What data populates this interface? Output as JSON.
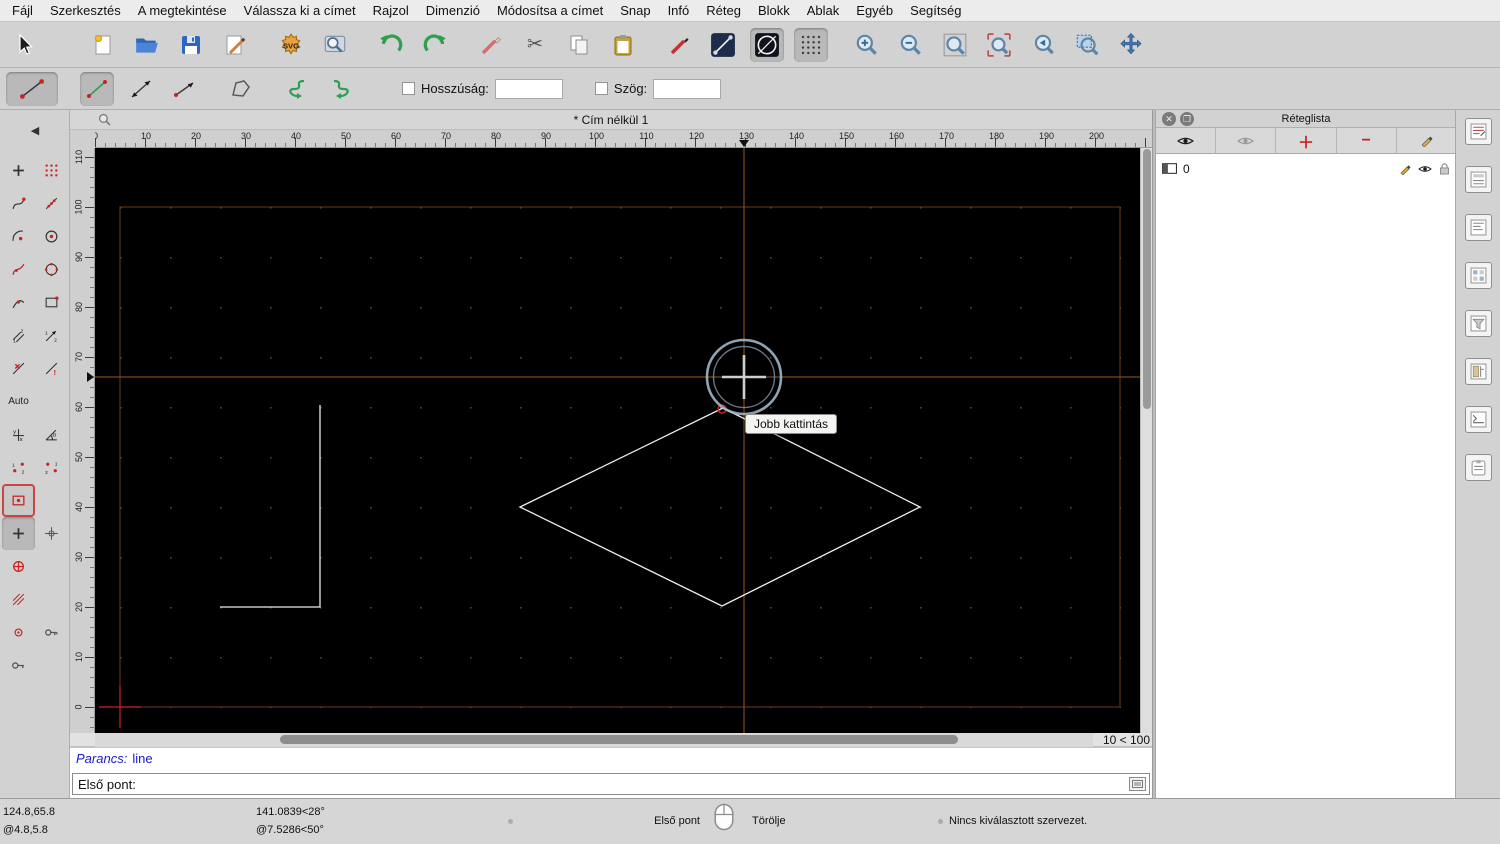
{
  "menu_bar": {
    "items": [
      "Fájl",
      "Szerkesztés",
      "A megtekintése",
      "Válassza ki a címet",
      "Rajzol",
      "Dimenzió",
      "Módosítsa a címet",
      "Snap",
      "Infó",
      "Réteg",
      "Blokk",
      "Ablak",
      "Egyéb",
      "Segítség"
    ]
  },
  "options_bar": {
    "length_label": "Hosszúság:",
    "length_value": "",
    "angle_label": "Szög:",
    "angle_value": ""
  },
  "titlebar": {
    "title": "* Cím nélkül 1"
  },
  "rulers": {
    "horizontal": [
      "0",
      "10",
      "20",
      "30",
      "40",
      "50",
      "60",
      "70",
      "80",
      "90",
      "100",
      "110",
      "120",
      "130",
      "140",
      "150",
      "160",
      "170",
      "180",
      "190",
      "200"
    ],
    "vertical": [
      "0",
      "10",
      "20",
      "30",
      "40",
      "50",
      "60",
      "70",
      "80",
      "90",
      "100",
      "110"
    ]
  },
  "canvas": {
    "tooltip": "Jobb kattintás",
    "zoom_range": "10 < 100"
  },
  "palette": {
    "auto_label": "Auto"
  },
  "layer_panel": {
    "title": "Réteglista",
    "layers": [
      {
        "name": "0"
      }
    ]
  },
  "command_area": {
    "prompt_label": "Parancs:",
    "command_text": "line",
    "input_text": "Első pont:"
  },
  "status_bar": {
    "coord_abs": "124.8,65.8",
    "coord_rel": "@4.8,5.8",
    "polar_abs": "141.0839<28°",
    "polar_rel": "@7.5286<50°",
    "left_mouse_action": "Első pont",
    "right_mouse_action": "Törölje",
    "selection_info": "Nincs kiválasztott szervezet."
  },
  "colors": {
    "canvas_bg": "#000000",
    "crosshair": "#9a5a1e",
    "paper_border": "#6e3c14",
    "drawing_line": "#ececec",
    "origin_cross": "#cc2222",
    "accent_red": "#cc2222"
  }
}
